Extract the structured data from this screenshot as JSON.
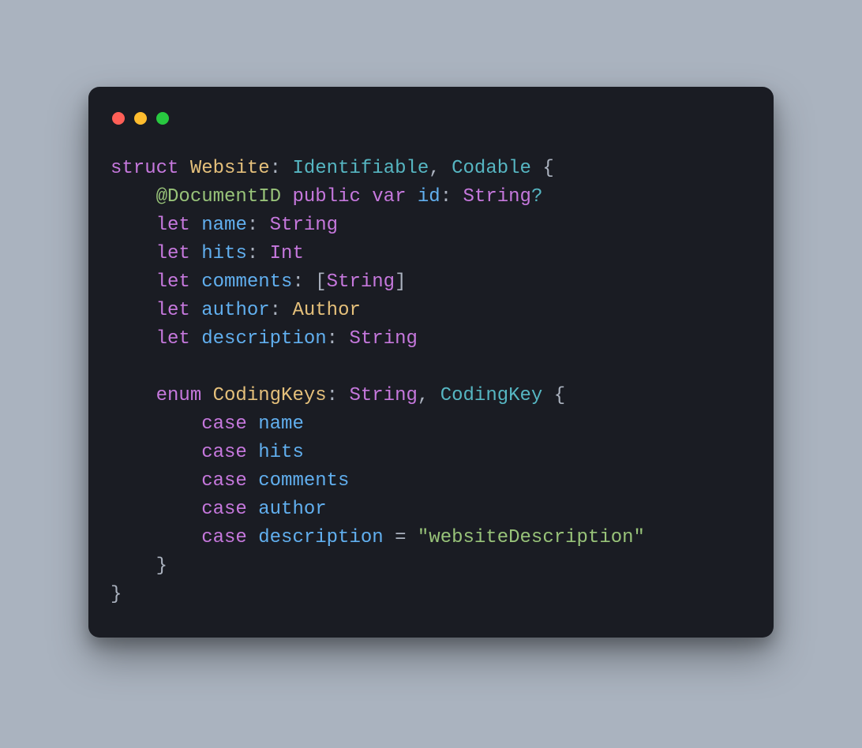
{
  "colors": {
    "background": "#aab3bf",
    "panel": "#1a1c23",
    "keyword": "#c678dd",
    "typename": "#e5c07b",
    "protocol": "#56b6c2",
    "identifier": "#61afef",
    "attribute": "#98c379",
    "string": "#98c379",
    "default": "#abb2bf"
  },
  "code": {
    "language": "swift",
    "struct_name": "Website",
    "conforms": [
      "Identifiable",
      "Codable"
    ],
    "document_id": {
      "attribute": "@DocumentID",
      "modifiers": [
        "public",
        "var"
      ],
      "name": "id",
      "type": "String",
      "optional": true
    },
    "properties": [
      {
        "kw": "let",
        "name": "name",
        "type": "String"
      },
      {
        "kw": "let",
        "name": "hits",
        "type": "Int"
      },
      {
        "kw": "let",
        "name": "comments",
        "type": "[String]"
      },
      {
        "kw": "let",
        "name": "author",
        "type": "Author"
      },
      {
        "kw": "let",
        "name": "description",
        "type": "String"
      }
    ],
    "enum": {
      "name": "CodingKeys",
      "raw_type": "String",
      "conforms": "CodingKey",
      "cases": [
        {
          "name": "name"
        },
        {
          "name": "hits"
        },
        {
          "name": "comments"
        },
        {
          "name": "author"
        },
        {
          "name": "description",
          "raw": "\"websiteDescription\""
        }
      ]
    },
    "keywords": {
      "struct": "struct",
      "enum": "enum",
      "case": "case",
      "let": "let",
      "public": "public",
      "var": "var"
    },
    "punct": {
      "open_brace": "{",
      "close_brace": "}",
      "colon": ":",
      "comma": ",",
      "lbracket": "[",
      "rbracket": "]",
      "equals": "=",
      "question": "?"
    }
  }
}
